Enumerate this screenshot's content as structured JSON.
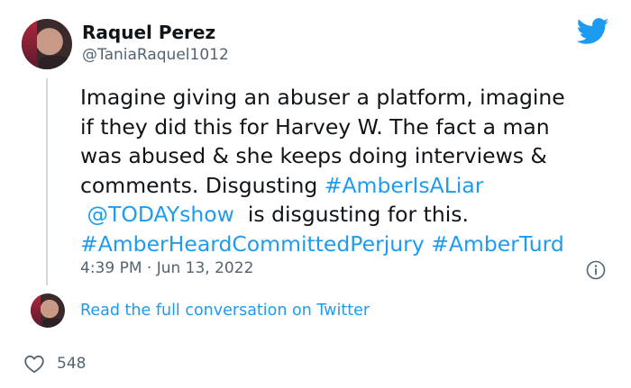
{
  "author": {
    "display_name": "Raquel Perez",
    "handle": "@TaniaRaquel1012"
  },
  "tweet": {
    "line1": "Imagine giving an abuser a platform, imagine",
    "line2": "if they did this for Harvey W. The fact a man",
    "line3": "was abused & she keeps doing interviews &",
    "line4_text": "comments. Disgusting ",
    "hashtag1": "#AmberIsALiar",
    "mention": "@TODAYshow",
    "line5_text": " is disgusting for this.",
    "hashtag2": "#AmberHeardCommittedPerjury",
    "hashtag3": "#AmberTurd",
    "timestamp": "4:39 PM · Jun 13, 2022"
  },
  "footer": {
    "read_more": "Read the full conversation on Twitter",
    "like_count": "548"
  },
  "icons": {
    "brand": "twitter-bird-icon",
    "info": "info-icon",
    "like": "heart-icon"
  },
  "colors": {
    "link": "#1d9bf0",
    "secondary_text": "#536471",
    "primary_text": "#0f1419",
    "brand": "#1d9bf0"
  }
}
